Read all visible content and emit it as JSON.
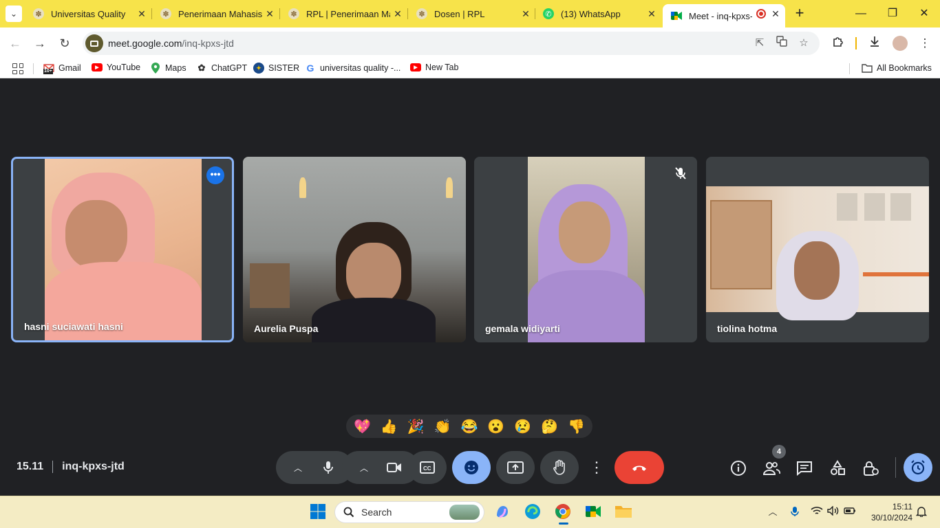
{
  "browser": {
    "tabs": [
      {
        "label": "Universitas Quality",
        "active": false
      },
      {
        "label": "Penerimaan Mahasisw",
        "active": false
      },
      {
        "label": "RPL | Penerimaan Mal",
        "active": false
      },
      {
        "label": "Dosen | RPL",
        "active": false
      },
      {
        "label": "(13) WhatsApp",
        "active": false
      },
      {
        "label": "Meet - inq-kpxs-j",
        "active": true
      }
    ],
    "url_host": "meet.google.com",
    "url_path": "/inq-kpxs-jtd",
    "bookmarks": [
      {
        "label": "Gmail",
        "icon": "gmail-icon"
      },
      {
        "label": "YouTube",
        "icon": "youtube-icon"
      },
      {
        "label": "Maps",
        "icon": "maps-icon"
      },
      {
        "label": "ChatGPT",
        "icon": "chatgpt-icon"
      },
      {
        "label": "SISTER",
        "icon": "sister-icon"
      },
      {
        "label": "universitas quality -...",
        "icon": "google-icon"
      },
      {
        "label": "New Tab",
        "icon": "youtube-icon"
      }
    ],
    "gmail_badge": "10+",
    "all_bookmarks": "All Bookmarks"
  },
  "meet": {
    "participants": [
      {
        "name": "hasni suciawati hasni",
        "active_speaker": true
      },
      {
        "name": "Aurelia Puspa",
        "active_speaker": false
      },
      {
        "name": "gemala widiyarti",
        "active_speaker": false,
        "muted": true
      },
      {
        "name": "tiolina hotma",
        "active_speaker": false
      }
    ],
    "reactions": [
      "💖",
      "👍",
      "🎉",
      "👏",
      "😂",
      "😮",
      "😢",
      "🤔",
      "👎"
    ],
    "time": "15.11",
    "meeting_code": "inq-kpxs-jtd",
    "people_count": "4",
    "colors": {
      "accent": "#8ab4f8",
      "end_call": "#ea4335",
      "bg": "#202124"
    }
  },
  "taskbar": {
    "search_placeholder": "Search",
    "time": "15:11",
    "date": "30/10/2024"
  }
}
